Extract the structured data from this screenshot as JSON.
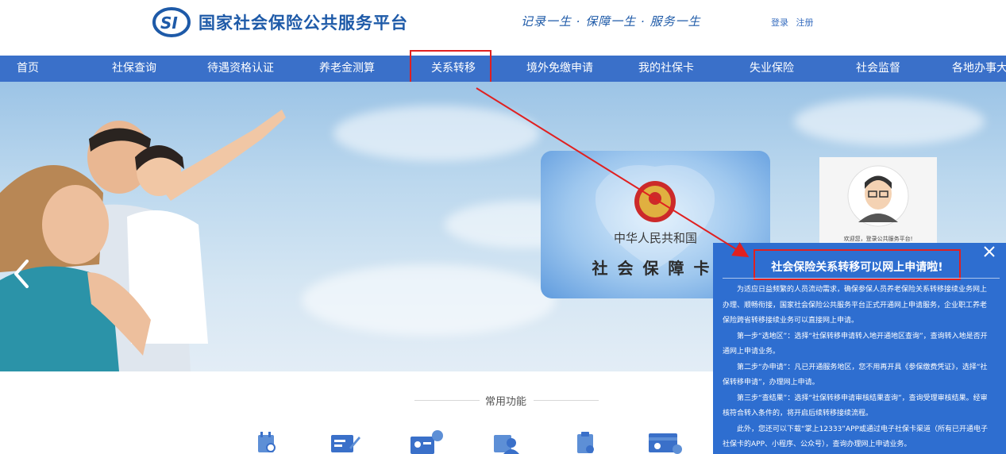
{
  "header": {
    "title": "国家社会保险公共服务平台",
    "slogan": "记录一生 · 保障一生 · 服务一生",
    "login": "登录",
    "register": "注册"
  },
  "nav": {
    "items": [
      {
        "label": "首页"
      },
      {
        "label": "社保查询"
      },
      {
        "label": "待遇资格认证"
      },
      {
        "label": "养老金测算"
      },
      {
        "label": "关系转移"
      },
      {
        "label": "境外免缴申请"
      },
      {
        "label": "我的社保卡"
      },
      {
        "label": "失业保险"
      },
      {
        "label": "社会监督"
      },
      {
        "label": "各地办事大"
      }
    ]
  },
  "banner": {
    "card_line1": "中华人民共和国",
    "card_line2": "社会保障卡",
    "login_welcome": "欢迎您，登录公共服务平台!"
  },
  "common": {
    "title": "常用功能"
  },
  "popup": {
    "title": "社会保险关系转移可以网上申请啦!",
    "paragraphs": [
      "为适应日益频繁的人员流动需求，确保参保人员养老保险关系转移接续业务网上办理、顺畅衔接，国家社会保险公共服务平台正式开通网上申请服务，企业职工养老保险跨省转移接续业务可以直接网上申请。",
      "第一步“选地区”：选择“社保转移申请转入地开通地区查询”，查询转入地是否开通网上申请业务。",
      "第二步“办申请”：凡已开通服务地区，您不用再开具《参保缴费凭证》，选择“社保转移申请”，办理网上申请。",
      "第三步“查结果”：选择“社保转移申请审核结果查询”，查询受理审核结果。经审核符合转入条件的，将开启后续转移接续流程。",
      "此外，您还可以下载“掌上12333”APP或通过电子社保卡渠道（所有已开通电子社保卡的APP、小程序、公众号），查询办理网上申请业务。"
    ]
  },
  "colors": {
    "brand": "#1e5aa8",
    "nav_bg": "#3a70c9",
    "popup_bg": "#2e6ed0",
    "highlight": "#e02020"
  }
}
